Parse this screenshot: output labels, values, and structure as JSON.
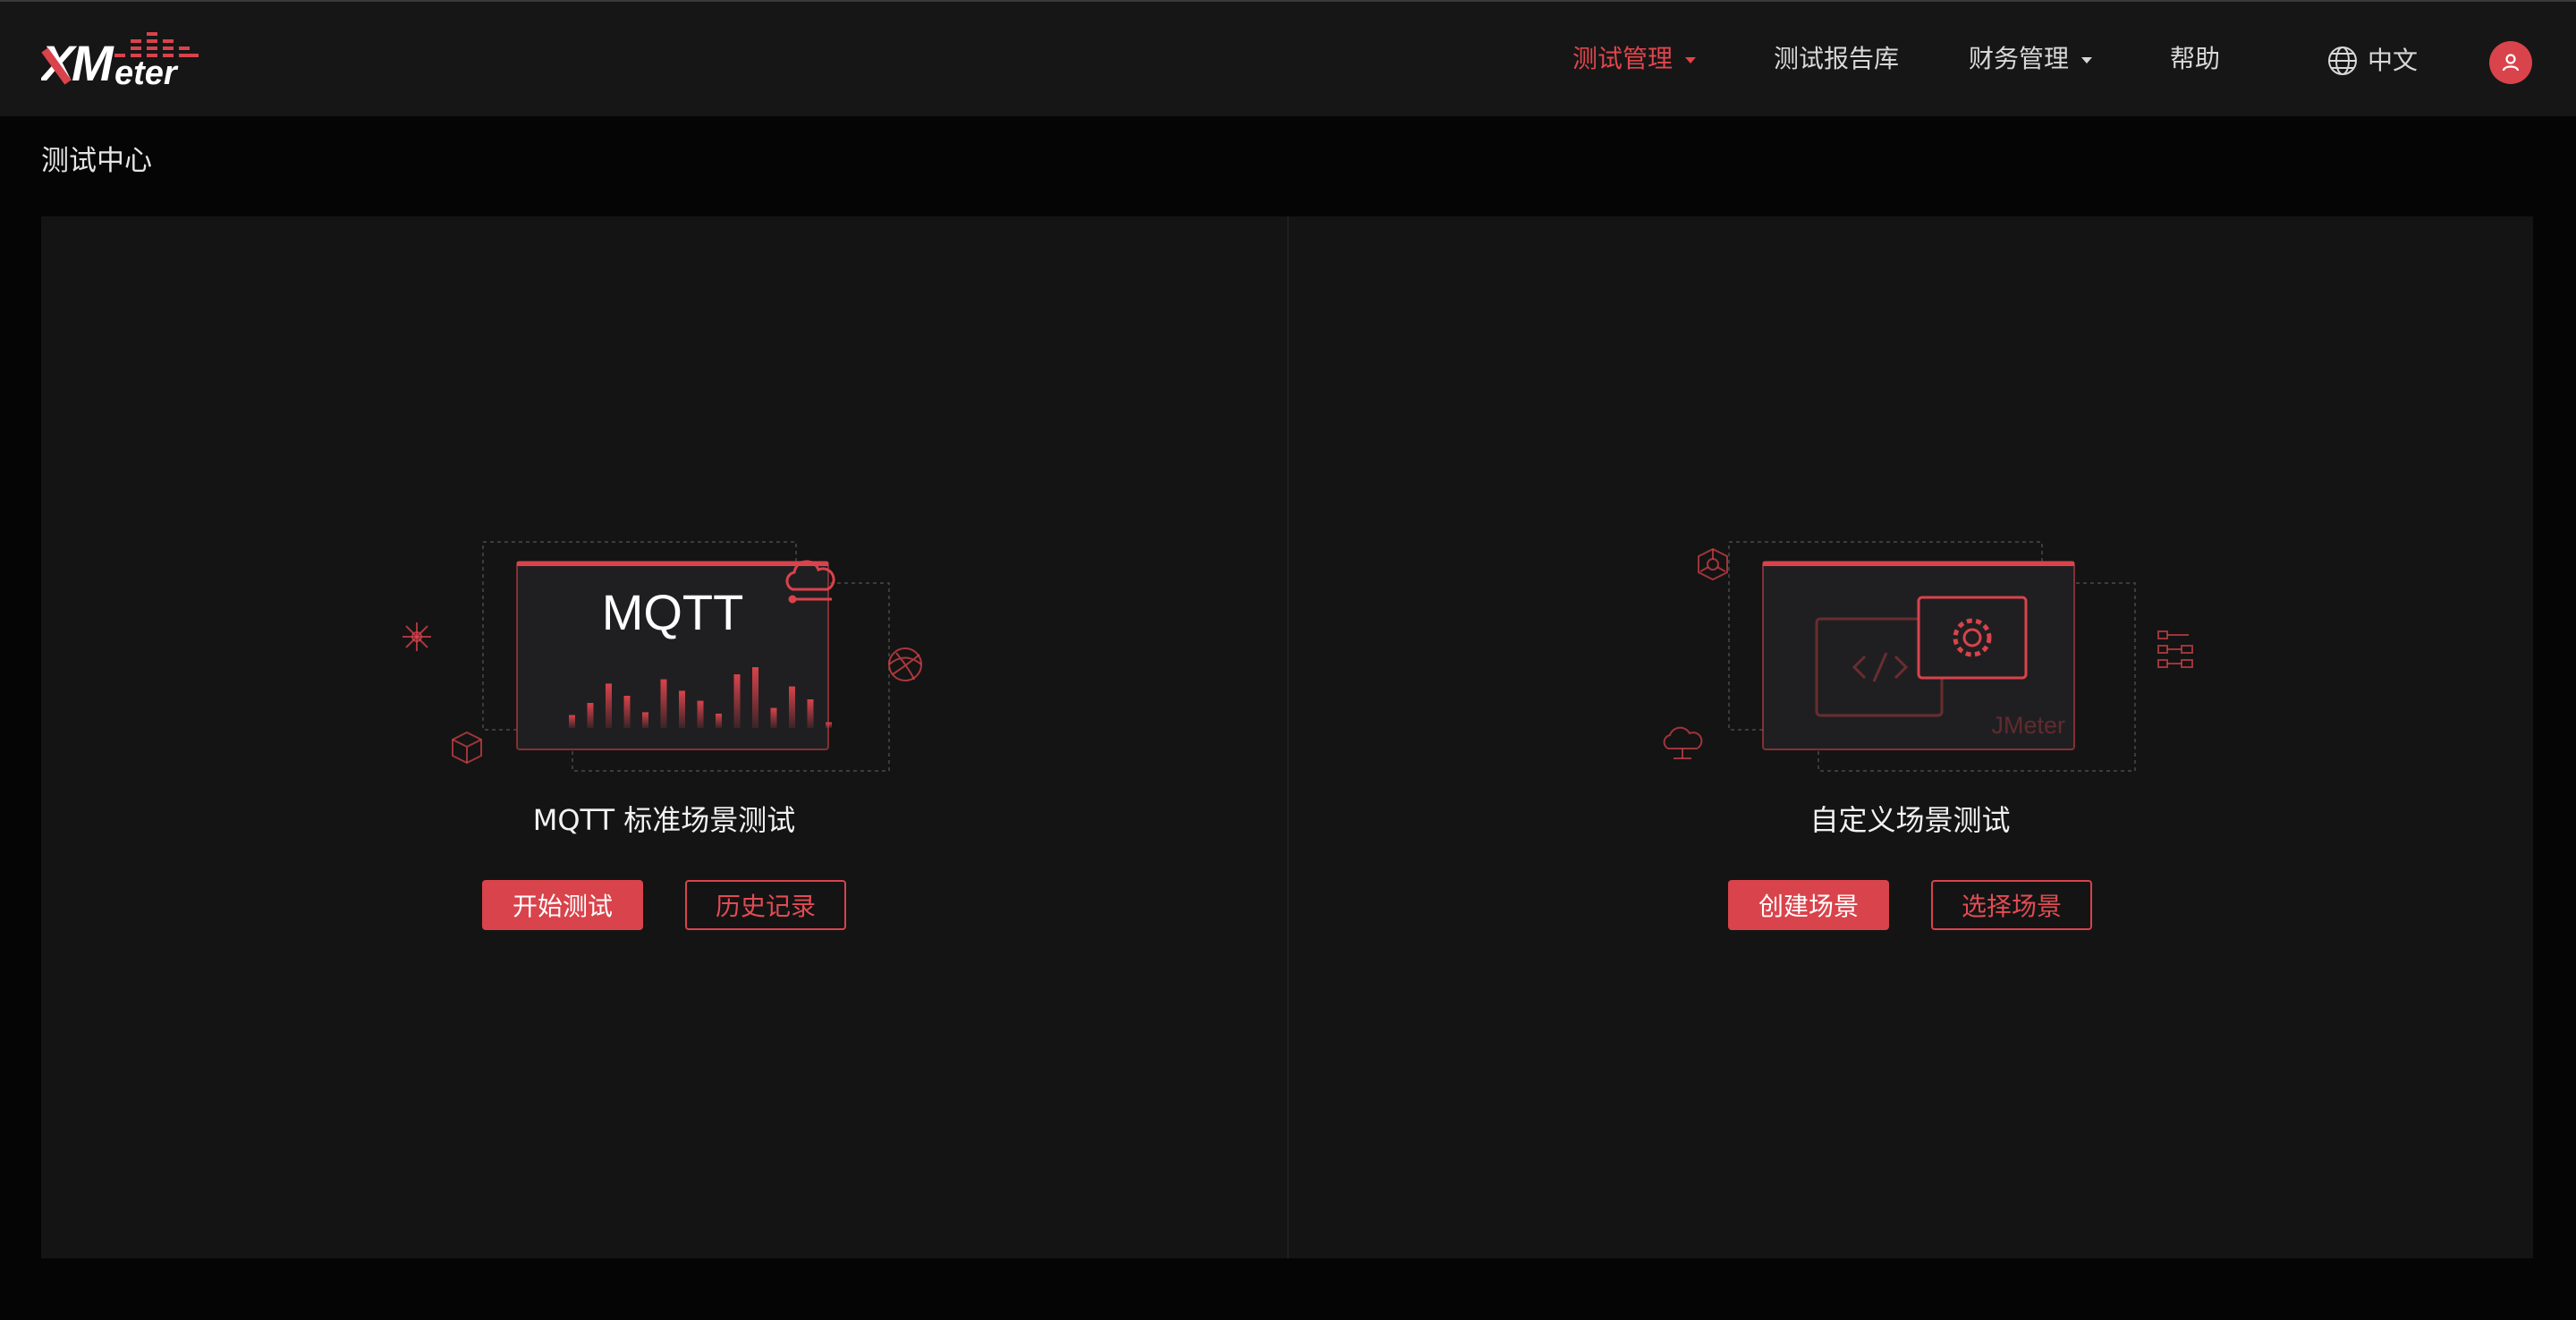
{
  "header": {
    "logo_text": "XMeter",
    "nav": [
      {
        "label": "测试管理",
        "active": true,
        "dropdown": true
      },
      {
        "label": "测试报告库",
        "active": false,
        "dropdown": false
      },
      {
        "label": "财务管理",
        "active": false,
        "dropdown": true
      },
      {
        "label": "帮助",
        "active": false,
        "dropdown": false
      }
    ],
    "language": {
      "icon": "globe-icon",
      "label": "中文"
    },
    "user_icon": "user-icon"
  },
  "page": {
    "title": "测试中心"
  },
  "cards": [
    {
      "title": "MQTT 标准场景测试",
      "illustration_label": "MQTT",
      "primary_button": "开始测试",
      "secondary_button": "历史记录",
      "bar_levels": [
        0.18,
        0.35,
        0.62,
        0.45,
        0.22,
        0.68,
        0.52,
        0.38,
        0.2,
        0.75,
        0.85,
        0.28,
        0.58,
        0.4,
        0.08
      ]
    },
    {
      "title": "自定义场景测试",
      "illustration_label": "JMeter",
      "primary_button": "创建场景",
      "secondary_button": "选择场景"
    }
  ],
  "colors": {
    "accent": "#d9434b",
    "header_bg": "#161616",
    "page_bg": "#050505",
    "panel_bg": "#141414"
  }
}
